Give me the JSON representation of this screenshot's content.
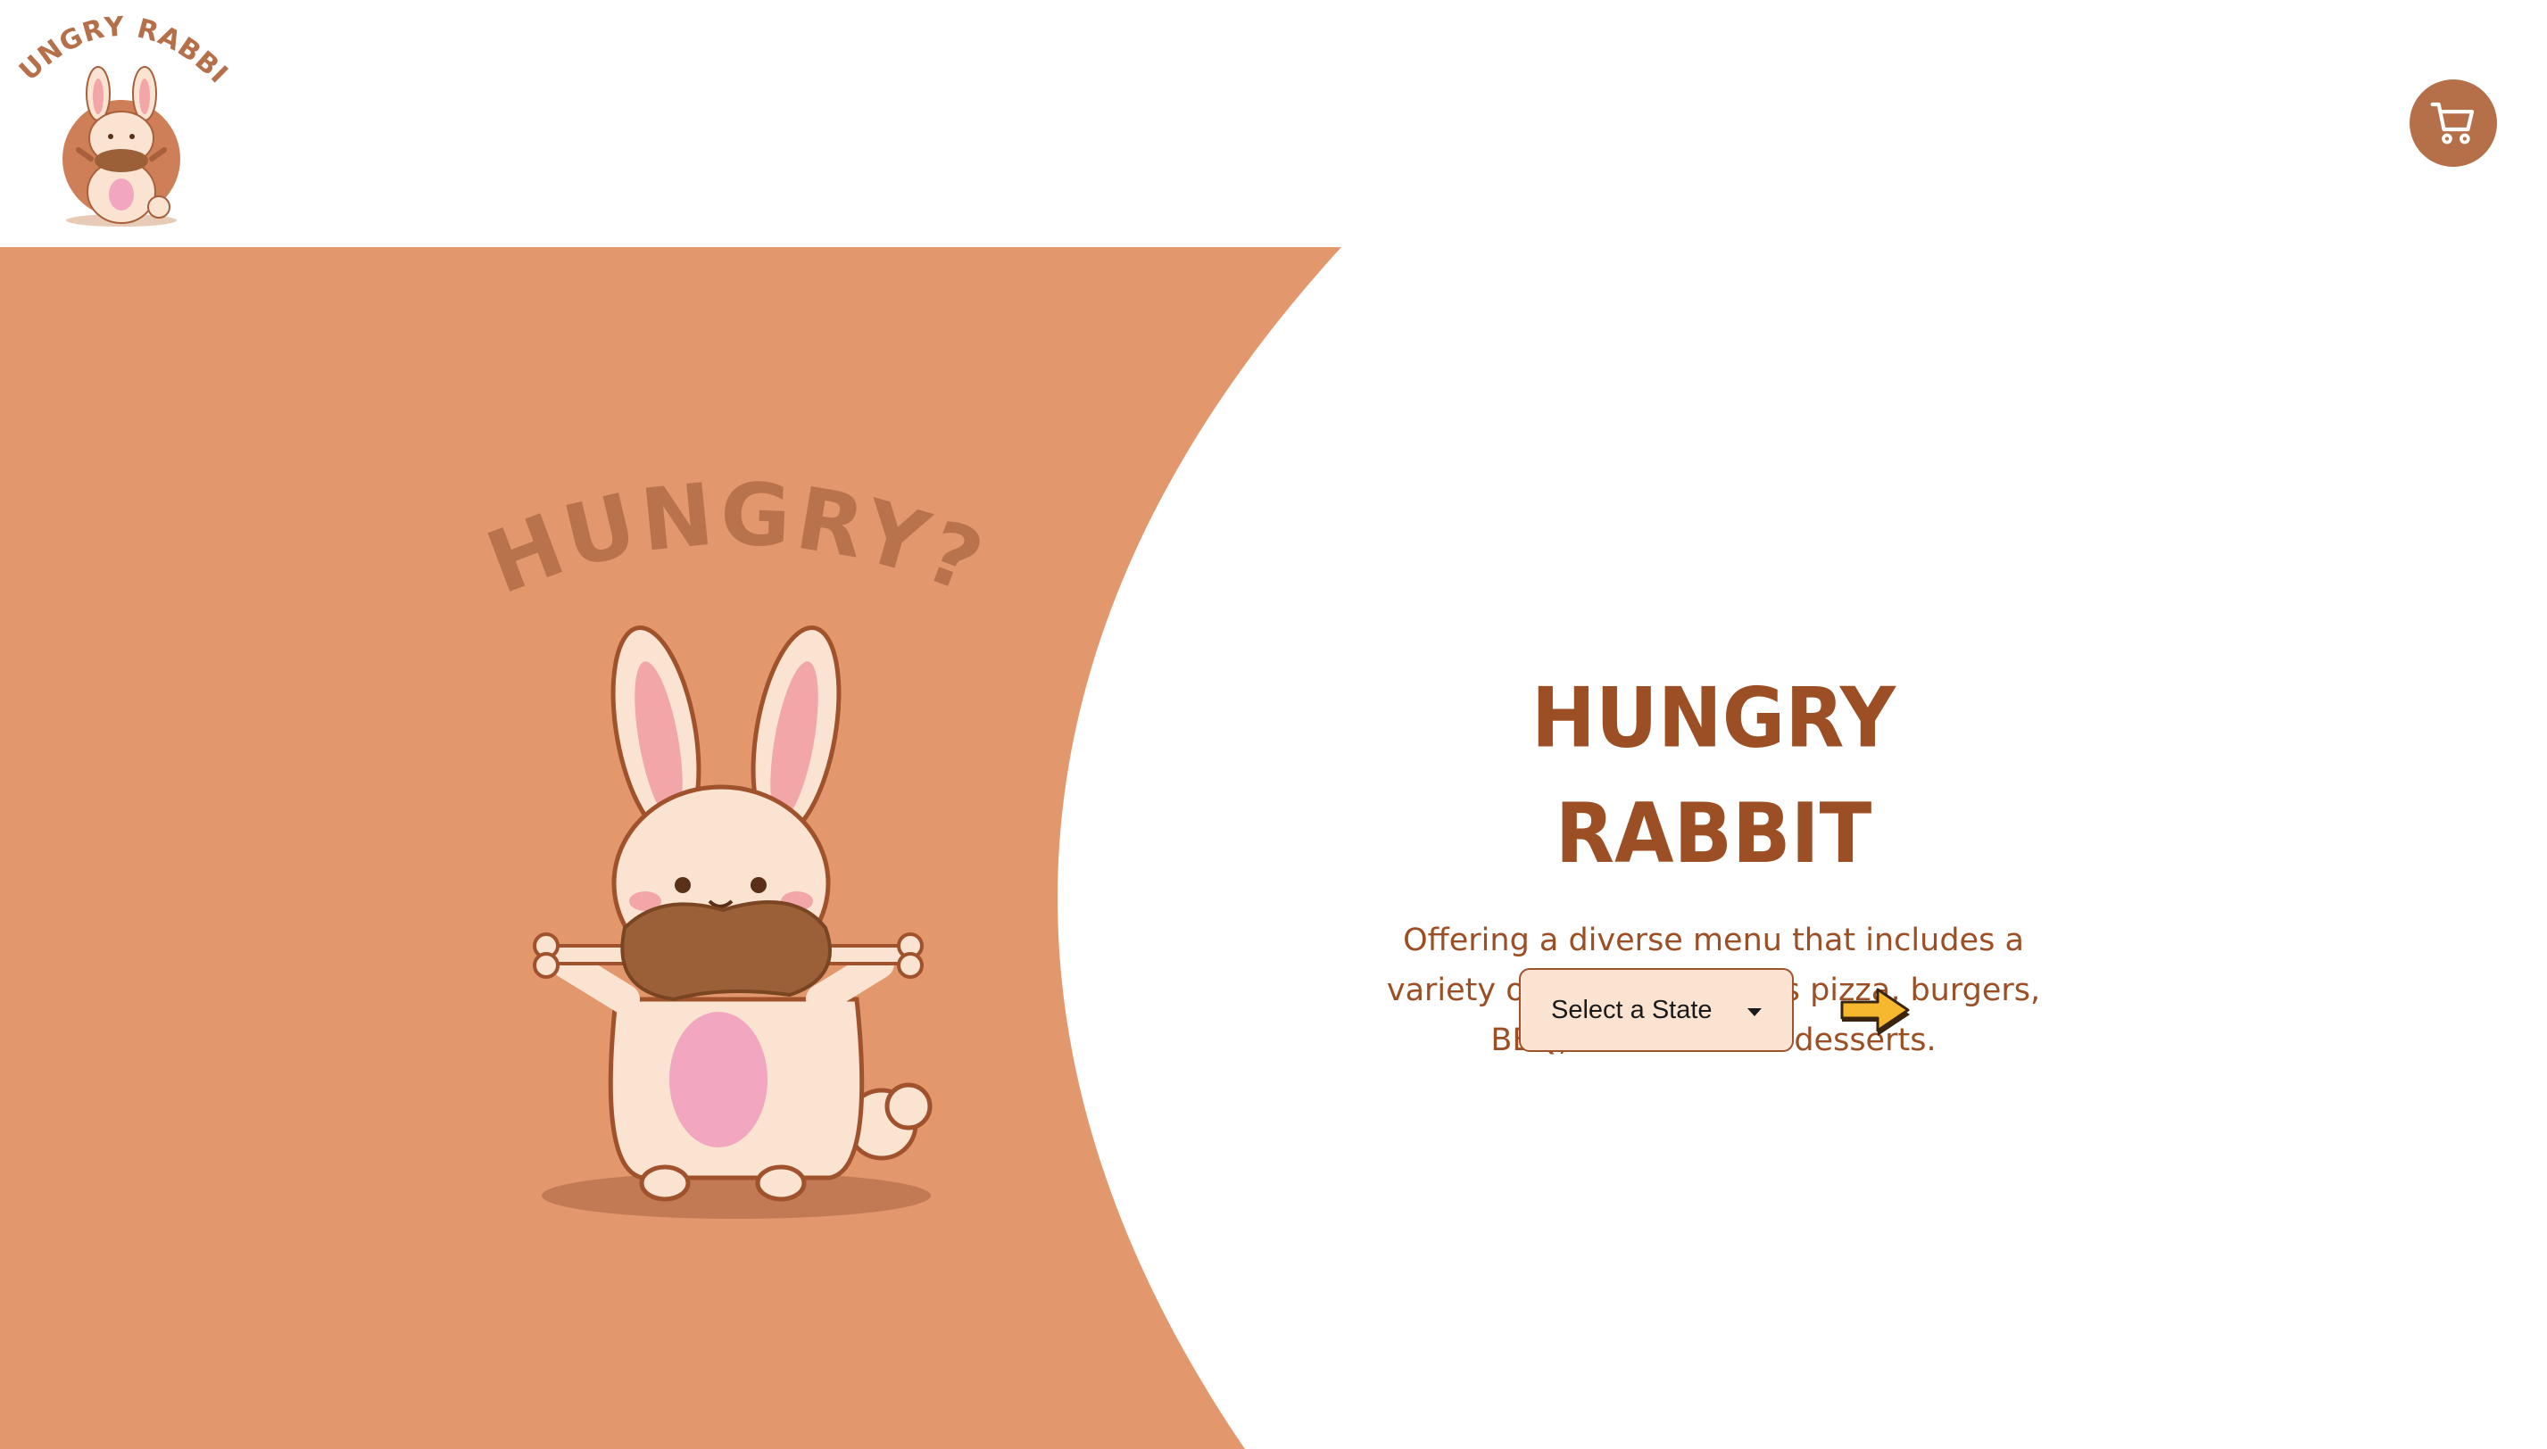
{
  "header": {
    "logo_text": "HUNGRY RABBIT",
    "cart_icon": "shopping-cart-icon"
  },
  "hero": {
    "illustration_text": "HUNGRY?",
    "title": "HUNGRY RABBIT",
    "tagline": "Offering a diverse menu that includes a variety of cuisines such as pizza, burgers, BBQ, and delicious desserts.",
    "state_select": {
      "selected": "Select a State"
    },
    "next_icon": "arrow-right-icon"
  },
  "colors": {
    "hero_background": "#e2976c",
    "brand_brown": "#9c4f25",
    "cart_button": "#b5704a",
    "select_background": "#fbe3d2",
    "arrow_yellow": "#f5b82e"
  }
}
